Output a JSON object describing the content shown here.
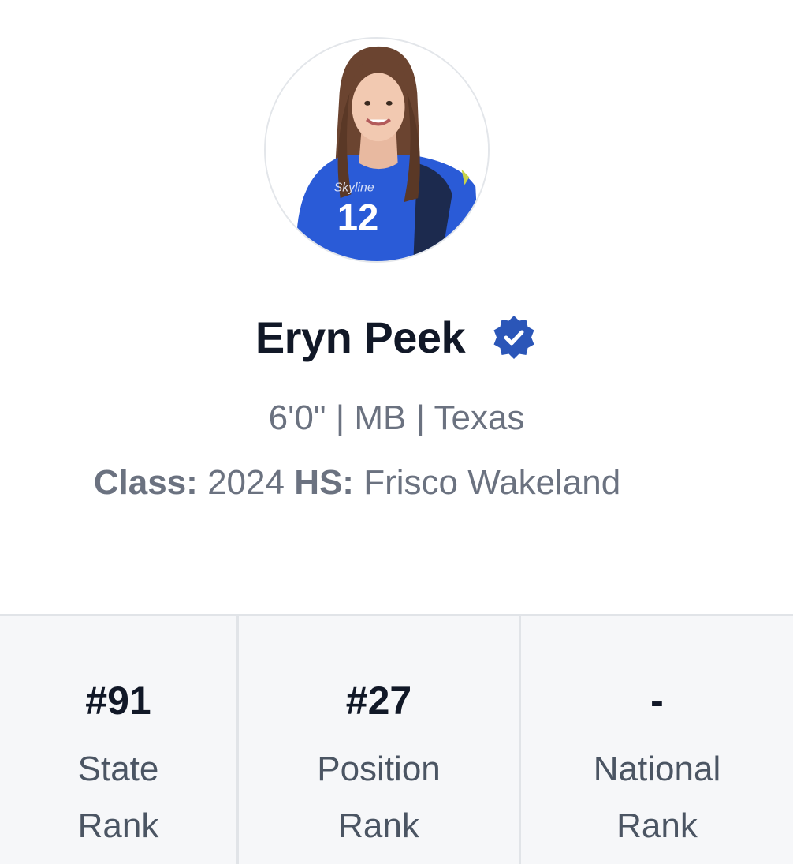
{
  "profile": {
    "name": "Eryn Peek",
    "verified_icon": "verified-badge-icon",
    "avatar_jersey_number": "12",
    "meta_line": "6'0\" | MB | Texas",
    "class_label": "Class:",
    "class_value": "2024",
    "hs_label": "HS:",
    "hs_value": "Frisco Wakeland"
  },
  "stats": [
    {
      "value": "#91",
      "label": "State Rank"
    },
    {
      "value": "#27",
      "label": "Position Rank"
    },
    {
      "value": "-",
      "label": "National Rank"
    }
  ],
  "colors": {
    "name_text": "#111827",
    "meta_text": "#6b7280",
    "verified_blue": "#2b56b8",
    "stats_bg": "#f6f7f9",
    "divider": "#e1e4e8",
    "jersey_blue": "#2a5bd7"
  }
}
